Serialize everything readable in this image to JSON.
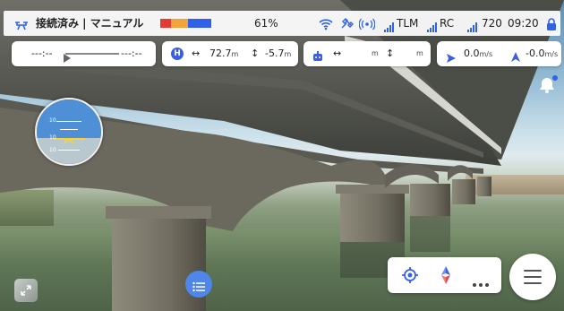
{
  "status_bar": {
    "mode_text": "接続済み | マニュアル",
    "battery_percent": "61%",
    "battery_segments": [
      {
        "color": "#e53935",
        "fraction": 0.19
      },
      {
        "color": "#f2a33a",
        "fraction": 0.3
      },
      {
        "color": "#2f62e8",
        "fraction": 0.41
      }
    ],
    "tlm_label": "TLM",
    "rc_label": "RC",
    "resolution": "720",
    "time": "09:20"
  },
  "telemetry": {
    "progress_left": "---:--",
    "progress_right": "---:--",
    "h_badge": "H",
    "horizontal_distance": "72.7",
    "horizontal_unit": "m",
    "vertical_distance": "-5.7",
    "vertical_unit": "m",
    "rc_distance_unit": "m",
    "rc_height_unit": "m",
    "horizontal_speed": "0.0",
    "horizontal_speed_unit": "m/s",
    "vertical_speed": "-0.0",
    "vertical_speed_unit": "m/s"
  },
  "attitude": {
    "pitch_labels": [
      "10",
      "10",
      "10"
    ]
  },
  "colors": {
    "accent": "#3a5ee6",
    "statusbar_bg": "#ffffff"
  },
  "icons": [
    "drone-icon",
    "wifi-icon",
    "gps-satellite-icon",
    "broadcast-icon",
    "signal-bars-icon",
    "lock-icon",
    "bell-icon",
    "list-icon",
    "locate-icon",
    "compass-icon",
    "more-icon",
    "hamburger-menu-icon",
    "map-thumbnail-icon"
  ]
}
